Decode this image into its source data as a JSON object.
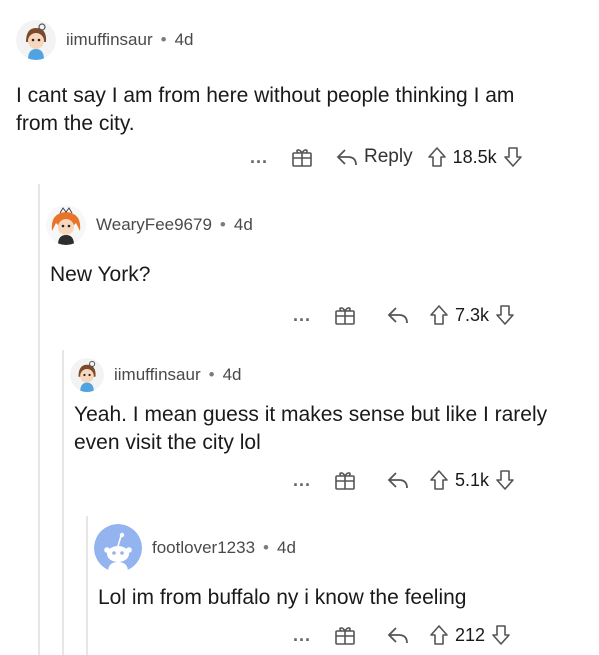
{
  "comments": [
    {
      "username": "iimuffinsaur",
      "separator": "•",
      "age": "4d",
      "text": "I cant say I am from here without people thinking I am from the city.",
      "more": "...",
      "reply": "Reply",
      "votes": "18.5k",
      "avatar": "muffin-avatar"
    },
    {
      "username": "WearyFee9679",
      "separator": "•",
      "age": "4d",
      "text": "New York?",
      "more": "...",
      "votes": "7.3k",
      "avatar": "orange-hair-avatar"
    },
    {
      "username": "iimuffinsaur",
      "separator": "•",
      "age": "4d",
      "text": "Yeah. I mean guess it makes sense but like I rarely even visit the city lol",
      "more": "...",
      "votes": "5.1k",
      "avatar": "muffin-avatar"
    },
    {
      "username": "footlover1233",
      "separator": "•",
      "age": "4d",
      "text": "Lol im from buffalo ny i know the feeling",
      "more": "...",
      "votes": "212",
      "avatar": "default-snoo-avatar"
    }
  ],
  "colors": {
    "text": "#1a1a1b",
    "meta": "#4a4a4a",
    "thread": "#e6e6e6",
    "snoo_bg": "#94b4f0"
  }
}
